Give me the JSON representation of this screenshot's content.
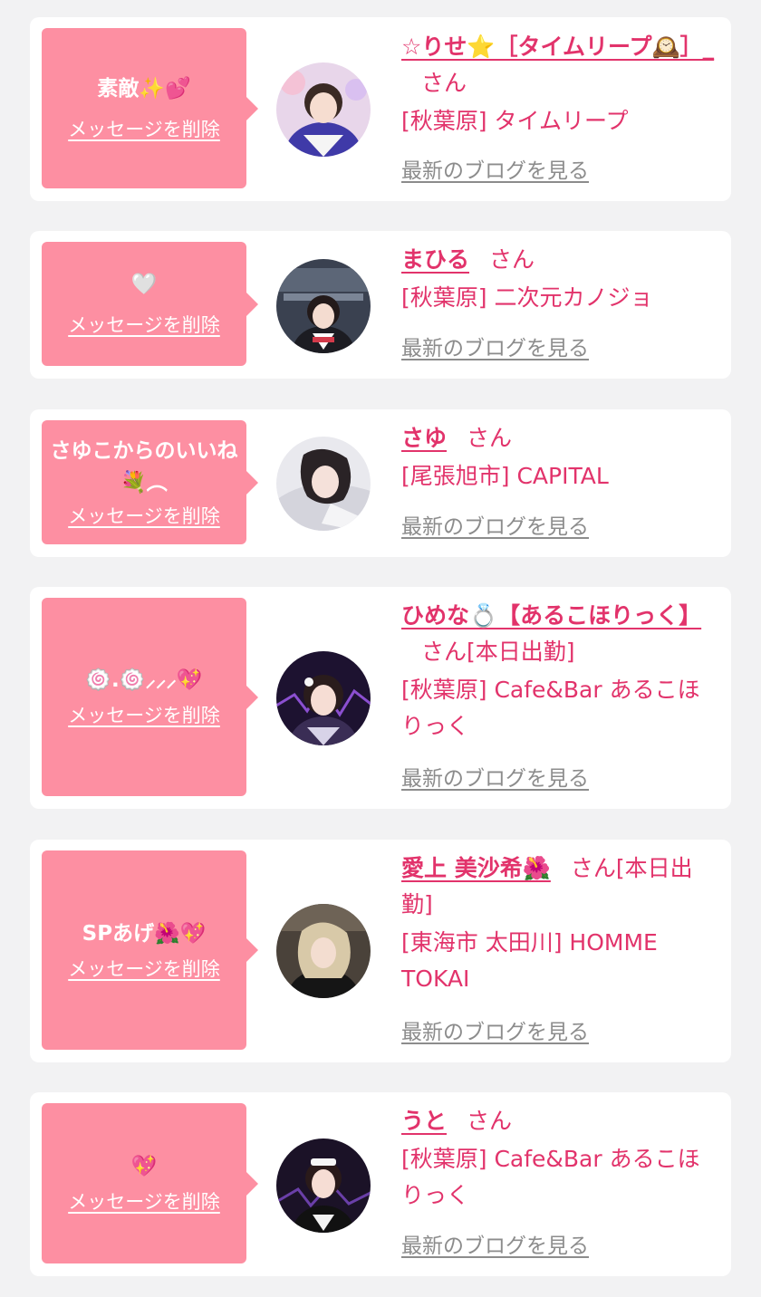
{
  "common": {
    "delete_label": "メッセージを削除",
    "san_label": "さん",
    "blog_label": "最新のブログを見る",
    "colors": {
      "bubble": "#fd8fa2",
      "accent": "#e2336b",
      "link_gray": "#8c8c8c"
    }
  },
  "messages": [
    {
      "message": "素敵✨💕",
      "name": "☆りせ⭐️［タイムリープ🕰️］_",
      "status": "",
      "shop": "[秋葉原] タイムリープ"
    },
    {
      "message": "🤍",
      "name": "まひる",
      "status": "",
      "shop": "[秋葉原] 二次元カノジョ"
    },
    {
      "message": "さゆこからのいいね💐︵",
      "name": "さゆ",
      "status": "",
      "shop": "[尾張旭市] CAPITAL"
    },
    {
      "message": "🍥.🍥⸝⸝⸝💖",
      "name": "ひめな💍【あるこほりっく】",
      "status": "[本日出勤]",
      "shop": "[秋葉原] Cafe&Bar あるこほりっく"
    },
    {
      "message": "SPあげ🌺💖",
      "name": "愛上 美沙希🌺",
      "status": "[本日出勤]",
      "shop": "[東海市 太田川] HOMME TOKAI"
    },
    {
      "message": "💖",
      "name": "うと",
      "status": "",
      "shop": "[秋葉原] Cafe&Bar あるこほりっく"
    }
  ]
}
